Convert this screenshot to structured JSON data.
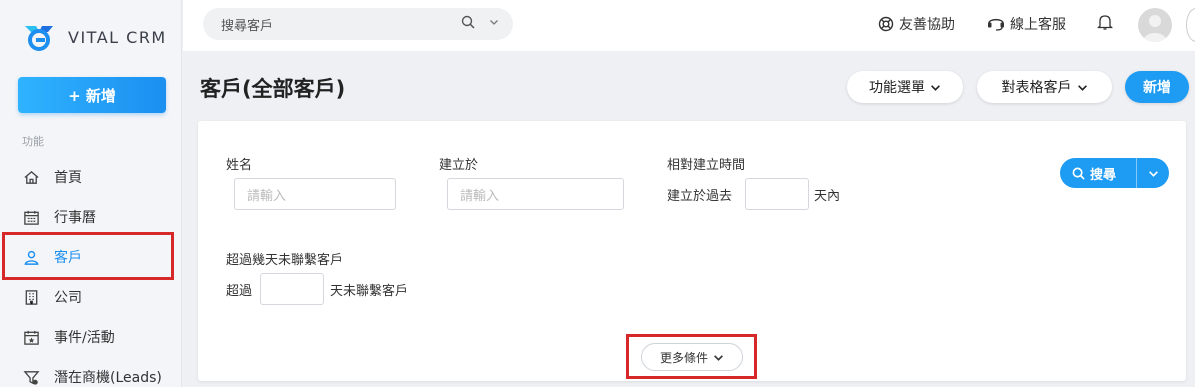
{
  "brand": {
    "name": "VITAL CRM",
    "accent": "#1e9bf2"
  },
  "sidebar": {
    "new_label": "+ 新增",
    "section_label": "功能",
    "items": [
      {
        "label": "首頁",
        "icon": "home-icon"
      },
      {
        "label": "行事曆",
        "icon": "calendar-icon"
      },
      {
        "label": "客戶",
        "icon": "customer-icon",
        "active": true
      },
      {
        "label": "公司",
        "icon": "building-icon"
      },
      {
        "label": "事件/活動",
        "icon": "event-icon"
      },
      {
        "label": "潛在商機(Leads)",
        "icon": "funnel-icon"
      }
    ]
  },
  "topbar": {
    "search_placeholder": "搜尋客戶",
    "help_label": "友善協助",
    "support_label": "線上客服"
  },
  "header": {
    "title": "客戶(全部客戶)",
    "menu_label": "功能選單",
    "table_label": "對表格客戶",
    "new_label": "新增"
  },
  "filters": {
    "name_label": "姓名",
    "name_placeholder": "請輸入",
    "created_label": "建立於",
    "created_placeholder": "請輸入",
    "relative_label": "相對建立時間",
    "relative_prefix": "建立於過去",
    "relative_suffix": "天內",
    "relative_value": "",
    "uncontacted_label": "超過幾天未聯繫客戶",
    "uncontacted_prefix": "超過",
    "uncontacted_suffix": "天未聯繫客戶",
    "uncontacted_value": "",
    "search_label": "搜尋",
    "more_label": "更多條件"
  }
}
